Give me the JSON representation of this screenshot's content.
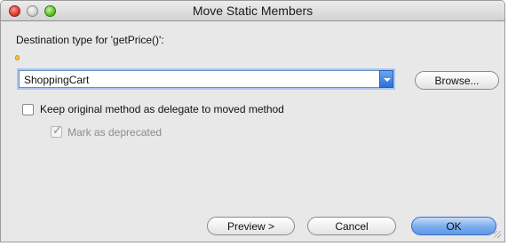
{
  "window": {
    "title": "Move Static Members"
  },
  "destination": {
    "label": "Destination type for 'getPrice()':",
    "value": "ShoppingCart",
    "browse_label": "Browse..."
  },
  "options": {
    "keep_original_label": "Keep original method as delegate to moved method",
    "keep_original_checked": false,
    "mark_deprecated_label": "Mark as deprecated",
    "mark_deprecated_checked": true,
    "mark_deprecated_enabled": false
  },
  "buttons": {
    "preview": "Preview >",
    "cancel": "Cancel",
    "ok": "OK"
  },
  "colors": {
    "default_button": "#7fb0ee",
    "focus_ring": "#a9c6f1",
    "close_light": "#d93a2c",
    "zoom_light": "#5cc12b",
    "hint_bulb": "#f4c542"
  },
  "icons": {
    "close": "close-traffic-light-icon",
    "minimize": "minimize-traffic-light-icon",
    "zoom": "zoom-traffic-light-icon",
    "hint": "lightbulb-icon",
    "dropdown": "chevron-down-icon",
    "checkmark": "checkmark-icon",
    "resize": "resize-grip-icon"
  }
}
